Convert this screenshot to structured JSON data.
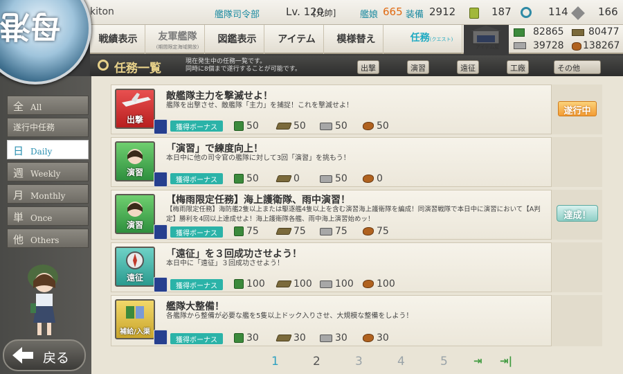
{
  "header": {
    "emblem_text": "母港",
    "player_name": "kiton",
    "rank_label": "艦隊司令部",
    "level": "Lv. 120",
    "rank_title": "[元帥]",
    "ships_label": "艦娘",
    "ships_count": "665",
    "equip_label": "装備",
    "equip_count": "2912",
    "bucket": "187",
    "devmat": "114",
    "screw": "166"
  },
  "nav": {
    "items": [
      {
        "label": "戦績表示",
        "sub": ""
      },
      {
        "label": "友軍艦隊",
        "sub": "(期間限定海域開放)"
      },
      {
        "label": "図鑑表示",
        "sub": ""
      },
      {
        "label": "アイテム",
        "sub": ""
      },
      {
        "label": "模様替え",
        "sub": ""
      },
      {
        "label": "任務",
        "sub": "(クエスト)"
      }
    ],
    "item_shop_label": "アイテム屋"
  },
  "resources": {
    "fuel": "82865",
    "ammo": "80477",
    "steel": "39728",
    "bauxite": "138267"
  },
  "titlebar": {
    "title": "任務一覧",
    "note_line1": "現在発生中の任務一覧です。",
    "note_line2": "同時に8個まで遂行することが可能です。",
    "tabs": [
      "出撃",
      "演習",
      "遠征",
      "工廠",
      "その他"
    ]
  },
  "filters": [
    {
      "kanji": "全",
      "label": "All"
    },
    {
      "kanji": "",
      "label": "遂行中任務"
    },
    {
      "kanji": "日",
      "label": "Daily"
    },
    {
      "kanji": "週",
      "label": "Weekly"
    },
    {
      "kanji": "月",
      "label": "Monthly"
    },
    {
      "kanji": "単",
      "label": "Once"
    },
    {
      "kanji": "他",
      "label": "Others"
    }
  ],
  "quests": [
    {
      "category": "出撃",
      "title": "敵艦隊主力を撃滅せよ！",
      "desc": "艦隊を出撃させ、敵艦隊「主力」を捕捉！これを撃滅せよ！",
      "bonus": "獲得ボーナス",
      "fuel": "50",
      "ammo": "50",
      "steel": "50",
      "baux": "50",
      "status": "遂行中"
    },
    {
      "category": "演習",
      "title": "「演習」で練度向上！",
      "desc": "本日中に他の司令官の艦隊に対して3回「演習」を挑もう！",
      "bonus": "獲得ボーナス",
      "fuel": "50",
      "ammo": "0",
      "steel": "50",
      "baux": "0",
      "status": ""
    },
    {
      "category": "演習",
      "title": "【梅雨限定任務】海上護衛隊、雨中演習！",
      "desc": "【梅雨限定任務】海防艦2隻以上または駆逐艦4隻以上を含む演習海上護衛隊を編成！同演習戦隊で本日中に演習において【A判定】勝利を4回以上達成せよ！海上護衛隊各艦、雨中海上演習始めッ！",
      "bonus": "獲得ボーナス",
      "fuel": "75",
      "ammo": "75",
      "steel": "75",
      "baux": "75",
      "status": "達成！"
    },
    {
      "category": "遠征",
      "title": "「遠征」を３回成功させよう！",
      "desc": "本日中に「遠征」３回成功させよう！",
      "bonus": "獲得ボーナス",
      "fuel": "100",
      "ammo": "100",
      "steel": "100",
      "baux": "100",
      "status": ""
    },
    {
      "category": "補給/入渠",
      "title": "艦隊大整備！",
      "desc": "各艦隊から整備が必要な艦を5隻以上ドック入りさせ、大規模な整備をしよう！",
      "bonus": "獲得ボーナス",
      "fuel": "30",
      "ammo": "30",
      "steel": "30",
      "baux": "30",
      "status": ""
    }
  ],
  "pager": {
    "pages": [
      "1",
      "2",
      "3",
      "4",
      "5"
    ],
    "current": "1"
  },
  "back_label": "戻る",
  "colors": {
    "accent": "#1faac2",
    "progress": "#f39c34",
    "done": "#8fcfc6",
    "bonus": "#2bb3a8"
  }
}
